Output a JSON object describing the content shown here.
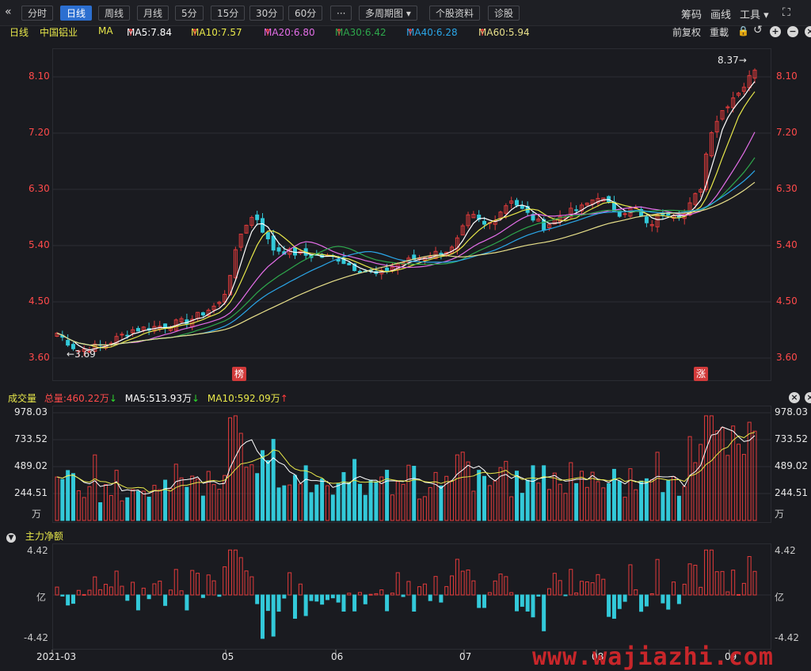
{
  "toolbar": {
    "back_icon": "double-chevron-left-icon",
    "tabs": [
      "分时",
      "日线",
      "周线",
      "月线",
      "5分",
      "15分",
      "30分",
      "60分",
      "···",
      "多周期图",
      "个股资料",
      "诊股"
    ],
    "active_tab": "日线",
    "right": [
      "筹码",
      "画线",
      "工具"
    ]
  },
  "mabar": {
    "period": "日线",
    "stock": "中国铝业",
    "ma_label": "MA",
    "ma5": "MA5:7.84",
    "ma10": "MA10:7.57",
    "ma20": "MA20:6.80",
    "ma30": "MA30:6.42",
    "ma40": "MA40:6.28",
    "ma60": "MA60:5.94",
    "adj": "前复权",
    "reset": "重載"
  },
  "colors": {
    "ma5": "#ffffff",
    "ma10": "#e8e84a",
    "ma20": "#e46ee8",
    "ma30": "#2ea84c",
    "ma40": "#2aa6e8",
    "ma60": "#e8e08a",
    "up": "#e23b3b",
    "down": "#33c9d9"
  },
  "price_axis": [
    "8.10",
    "7.20",
    "6.30",
    "5.40",
    "4.50",
    "3.60"
  ],
  "price_markers": {
    "high": "8.37",
    "low": "3.69"
  },
  "badges": [
    "榜",
    "涨"
  ],
  "volume": {
    "title": "成交量",
    "total": "总量:460.22万",
    "ma5": "MA5:513.93万",
    "ma10": "MA10:592.09万",
    "axis": [
      "978.03",
      "733.52",
      "489.02",
      "244.51"
    ],
    "unit": "万"
  },
  "flow": {
    "title": "主力净额",
    "axis_top": "4.42",
    "axis_mid": "亿",
    "axis_bottom": "-4.42"
  },
  "date_axis": [
    "2021-03",
    "05",
    "06",
    "07",
    "08",
    "09"
  ],
  "watermark": "www.wajiazhi.com",
  "chart_data": {
    "type": "candlestick",
    "title": "中国铝业",
    "ylim": [
      3.6,
      8.6
    ],
    "high": 8.37,
    "low": 3.69,
    "close_last": 8.25,
    "ma_values": {
      "MA5": 7.84,
      "MA10": 7.57,
      "MA20": 6.8,
      "MA30": 6.42,
      "MA40": 6.28,
      "MA60": 5.94
    },
    "volume_ylim": [
      0,
      978.03
    ]
  }
}
